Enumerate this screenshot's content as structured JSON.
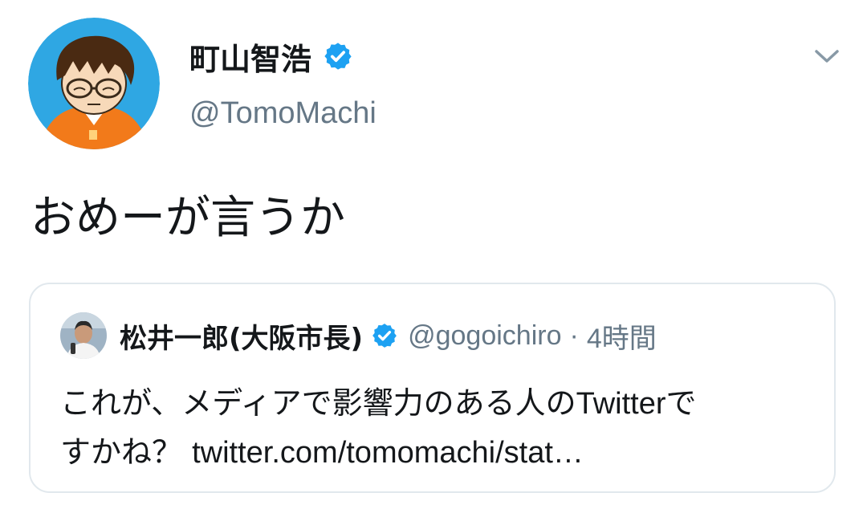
{
  "tweet": {
    "author": {
      "name": "町山智浩",
      "handle": "@TomoMachi",
      "verified": true,
      "avatar_icon": "cartoon-avatar-glasses-orange-shirt"
    },
    "text": "おめーが言うか",
    "menu_icon": "chevron-down-icon"
  },
  "quote": {
    "author": {
      "name": "松井一郎(大阪市長)",
      "handle": "@gogoichiro",
      "verified": true,
      "avatar_icon": "photo-avatar-man-speaking"
    },
    "separator": "·",
    "time": "4時間",
    "text_line1_jp": "これが、メディアで影響力のある人の",
    "text_line1_latin": "Twitter",
    "text_line1_end": "で",
    "text_line2_jp": "すかね？ ",
    "text_line2_link": "twitter.com/tomomachi/stat…"
  },
  "colors": {
    "text_primary": "#14171a",
    "text_secondary": "#657786",
    "verified_blue": "#1da1f2",
    "border": "#e1e8ed",
    "avatar_bg": "#2fa7e3",
    "shirt_orange": "#f27a1a"
  }
}
